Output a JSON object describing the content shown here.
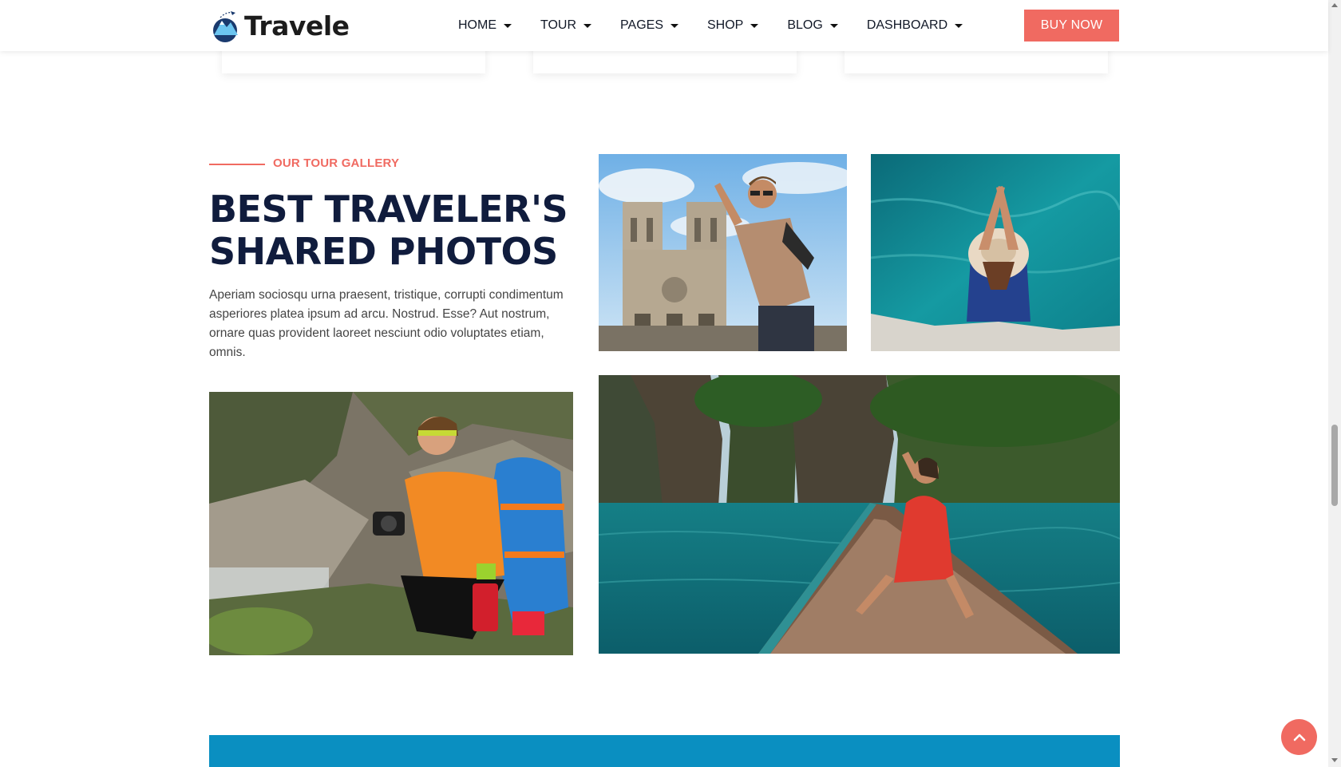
{
  "brand": {
    "name": "Travele",
    "logo_icon": "mountain-plane-logo-icon"
  },
  "nav": {
    "items": [
      {
        "label": "HOME"
      },
      {
        "label": "TOUR"
      },
      {
        "label": "PAGES"
      },
      {
        "label": "SHOP"
      },
      {
        "label": "BLOG"
      },
      {
        "label": "DASHBOARD"
      }
    ],
    "buy_label": "BUY NOW"
  },
  "gallery": {
    "eyebrow": "OUR TOUR GALLERY",
    "title": "BEST TRAVELER'S SHARED PHOTOS",
    "description": "Aperiam sociosqu urna praesent, tristique, corrupti condimentum asperiores platea ipsum ad arcu. Nostrud. Esse? Aut nostrum, ornare quas provident laoreet nesciunt odio voluptates etiam, omnis.",
    "photos": [
      {
        "subject": "traveler-at-notre-dame-photo"
      },
      {
        "subject": "woman-in-hat-by-sea-photo"
      },
      {
        "subject": "hiker-with-camera-photo"
      },
      {
        "subject": "woman-on-boat-lake-photo"
      }
    ]
  },
  "colors": {
    "accent": "#f06a61",
    "heading": "#101c3d",
    "band": "#0a8fc1"
  },
  "scroll_top": {
    "icon": "chevron-up-icon"
  }
}
